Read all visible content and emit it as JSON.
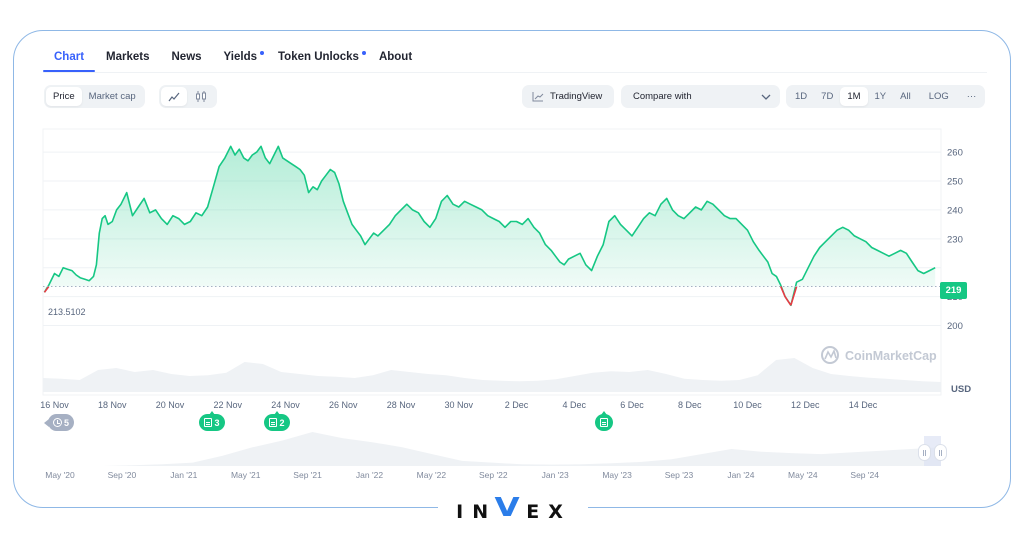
{
  "tabs": [
    {
      "label": "Chart",
      "active": true,
      "dot": false
    },
    {
      "label": "Markets",
      "active": false,
      "dot": false
    },
    {
      "label": "News",
      "active": false,
      "dot": false
    },
    {
      "label": "Yields",
      "active": false,
      "dot": true
    },
    {
      "label": "Token Unlocks",
      "active": false,
      "dot": true
    },
    {
      "label": "About",
      "active": false,
      "dot": false
    }
  ],
  "toolbar": {
    "metric_options": [
      "Price",
      "Market cap"
    ],
    "metric_selected": "Price",
    "chart_type_icons": [
      "line-chart-icon",
      "candlestick-icon"
    ],
    "chart_type_selected": "line-chart-icon",
    "tradingview_label": "TradingView",
    "compare_placeholder": "Compare with",
    "ranges": [
      "1D",
      "7D",
      "1M",
      "1Y",
      "All"
    ],
    "range_selected": "1M",
    "log_label": "LOG",
    "more_label": "···"
  },
  "watermark": "CoinMarketCap",
  "brand": {
    "pre": "IN",
    "accent": "V",
    "post": "EX",
    "accent_color": "#2b7de9"
  },
  "colors": {
    "up": "#16c784",
    "down": "#ea3943",
    "accent": "#3861fb"
  },
  "events": [
    {
      "kind": "history",
      "label": "5",
      "date": "16 Nov"
    },
    {
      "kind": "news",
      "label": "3",
      "date": "21 Nov"
    },
    {
      "kind": "news",
      "label": "2",
      "date": "23 Nov"
    },
    {
      "kind": "news",
      "label": "",
      "date": "4 Dec"
    }
  ],
  "chart_data": {
    "type": "area",
    "title": "",
    "currency_label": "USD",
    "baseline": 213.5102,
    "baseline_label": "213.5102",
    "current_price": 219,
    "current_price_label": "219",
    "ylim": [
      195,
      268
    ],
    "y_ticks": [
      200,
      210,
      220,
      230,
      240,
      250,
      260
    ],
    "y_tick_labels": [
      "200",
      "210",
      "",
      "230",
      "240",
      "250",
      "260"
    ],
    "xlim_days": [
      -0.4,
      30.7
    ],
    "x_ticks": [
      {
        "day": 0,
        "label": "16 Nov"
      },
      {
        "day": 2,
        "label": "18 Nov"
      },
      {
        "day": 4,
        "label": "20 Nov"
      },
      {
        "day": 6,
        "label": "22 Nov"
      },
      {
        "day": 8,
        "label": "24 Nov"
      },
      {
        "day": 10,
        "label": "26 Nov"
      },
      {
        "day": 12,
        "label": "28 Nov"
      },
      {
        "day": 14,
        "label": "30 Nov"
      },
      {
        "day": 16,
        "label": "2 Dec"
      },
      {
        "day": 18,
        "label": "4 Dec"
      },
      {
        "day": 20,
        "label": "6 Dec"
      },
      {
        "day": 22,
        "label": "8 Dec"
      },
      {
        "day": 24,
        "label": "10 Dec"
      },
      {
        "day": 26,
        "label": "12 Dec"
      },
      {
        "day": 28,
        "label": "14 Dec"
      }
    ],
    "grid": true,
    "series": [
      {
        "name": "Price (USD)",
        "x_days": [
          -0.35,
          -0.2,
          0.0,
          0.15,
          0.3,
          0.45,
          0.6,
          0.75,
          0.9,
          1.05,
          1.2,
          1.35,
          1.45,
          1.55,
          1.65,
          1.75,
          1.85,
          2.0,
          2.15,
          2.3,
          2.5,
          2.7,
          2.9,
          3.1,
          3.3,
          3.5,
          3.7,
          3.9,
          4.1,
          4.3,
          4.5,
          4.7,
          4.9,
          5.1,
          5.3,
          5.5,
          5.7,
          5.9,
          6.1,
          6.25,
          6.4,
          6.55,
          6.7,
          6.85,
          7.0,
          7.15,
          7.3,
          7.45,
          7.6,
          7.75,
          7.9,
          8.05,
          8.2,
          8.35,
          8.5,
          8.65,
          8.8,
          8.95,
          9.1,
          9.25,
          9.4,
          9.55,
          9.7,
          9.85,
          10.0,
          10.15,
          10.3,
          10.45,
          10.6,
          10.75,
          10.9,
          11.05,
          11.2,
          11.4,
          11.6,
          11.8,
          12.0,
          12.2,
          12.4,
          12.6,
          12.8,
          13.0,
          13.2,
          13.4,
          13.6,
          13.8,
          14.0,
          14.2,
          14.4,
          14.6,
          14.8,
          15.0,
          15.2,
          15.4,
          15.6,
          15.8,
          16.0,
          16.2,
          16.4,
          16.6,
          16.8,
          17.0,
          17.2,
          17.35,
          17.5,
          17.65,
          17.8,
          18.0,
          18.2,
          18.4,
          18.6,
          18.8,
          19.0,
          19.2,
          19.4,
          19.6,
          19.8,
          20.0,
          20.2,
          20.4,
          20.6,
          20.8,
          21.0,
          21.2,
          21.4,
          21.6,
          21.8,
          22.0,
          22.2,
          22.4,
          22.6,
          22.8,
          23.0,
          23.2,
          23.4,
          23.6,
          23.8,
          24.0,
          24.2,
          24.4,
          24.55,
          24.7,
          24.85,
          25.0,
          25.15,
          25.3,
          25.5,
          25.7,
          25.9,
          26.1,
          26.3,
          26.5,
          26.7,
          26.9,
          27.1,
          27.3,
          27.5,
          27.7,
          27.9,
          28.1,
          28.3,
          28.5,
          28.7,
          28.9,
          29.1,
          29.3,
          29.5,
          29.7,
          29.9,
          30.1,
          30.3,
          30.5
        ],
        "values": [
          211.5,
          214,
          218,
          217,
          220,
          219.5,
          219,
          217.5,
          216.5,
          216,
          215.5,
          217,
          221,
          232,
          237,
          238,
          235,
          236,
          240,
          242,
          246,
          238,
          241,
          244,
          239,
          240,
          237,
          235,
          238,
          237,
          235,
          236,
          239,
          238,
          241,
          248,
          255,
          258,
          262,
          259,
          261,
          258,
          257,
          259,
          260,
          262,
          258,
          256,
          259,
          262,
          258,
          257,
          256,
          255,
          254,
          252,
          246,
          248,
          247,
          250,
          252,
          254,
          253,
          249,
          243,
          239,
          235,
          233,
          231,
          228,
          230,
          232,
          231,
          233,
          235,
          238,
          240,
          242,
          240,
          239,
          236,
          234,
          237,
          243,
          245,
          242,
          241,
          243,
          242,
          241,
          240,
          238,
          237,
          236,
          234,
          236,
          236,
          235,
          237,
          234,
          232,
          228,
          226,
          224,
          222,
          221,
          223,
          224,
          225,
          221,
          219,
          224,
          228,
          236,
          238,
          235,
          233,
          231,
          234,
          237,
          239,
          238,
          242,
          244,
          240,
          238,
          237,
          239,
          241,
          240,
          243,
          242,
          240,
          238,
          237,
          237,
          235,
          233,
          229,
          226,
          224,
          222,
          218,
          217,
          214,
          210,
          207,
          215,
          216,
          220,
          224,
          227,
          229,
          231,
          233,
          234,
          233,
          231,
          230,
          229,
          227,
          226,
          225,
          224,
          225,
          226,
          225,
          222,
          219,
          218,
          219,
          220
        ]
      }
    ],
    "volume_note": "light gray volume area below price",
    "navigator": {
      "type": "area",
      "x_labels": [
        "May '20",
        "Sep '20",
        "Jan '21",
        "May '21",
        "Sep '21",
        "Jan '22",
        "May '22",
        "Sep '22",
        "Jan '23",
        "May '23",
        "Sep '23",
        "Jan '24",
        "May '24",
        "Sep '24"
      ],
      "values": [
        0,
        0,
        0,
        0.02,
        0.05,
        0.1,
        0.3,
        0.55,
        0.75,
        1.0,
        0.82,
        0.7,
        0.55,
        0.35,
        0.15,
        0.1,
        0.05,
        0.04,
        0.05,
        0.08,
        0.12,
        0.2,
        0.35,
        0.5,
        0.42,
        0.38,
        0.35,
        0.4,
        0.45,
        0.5,
        0.55
      ]
    }
  }
}
